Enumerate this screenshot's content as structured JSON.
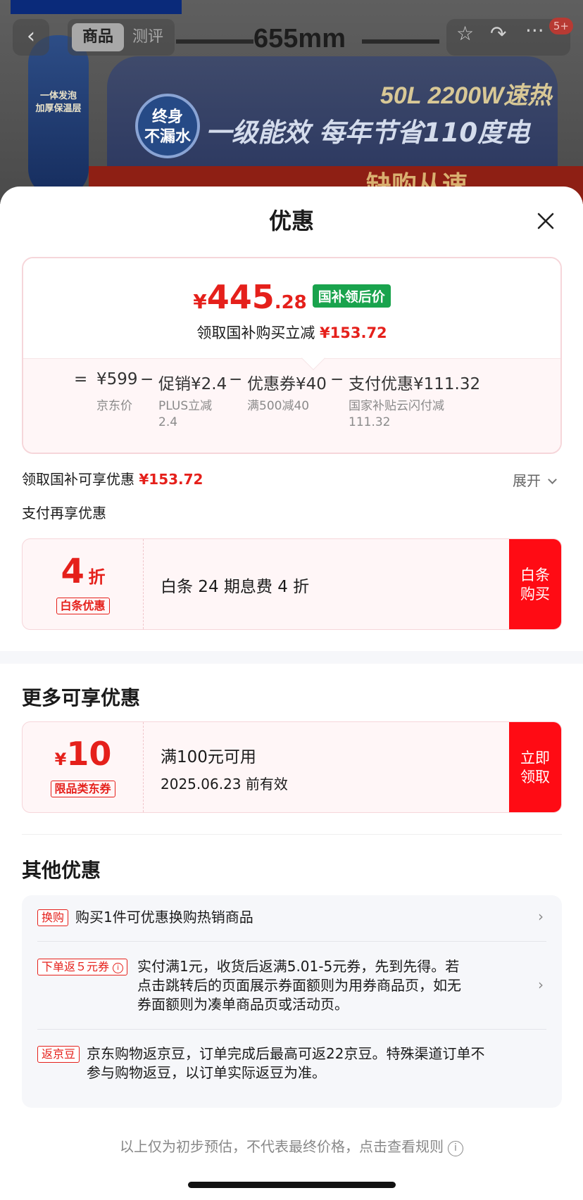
{
  "background": {
    "nav_back_label": "‹",
    "tabs": [
      "商品",
      "测评"
    ],
    "dimension_text": "655mm",
    "notification_badge": "5+",
    "pill_texts": [
      "一体发泡",
      "加厚保温层"
    ],
    "banner_capacity": "50L",
    "banner_power": "2200W速热",
    "banner_seal": [
      "终身",
      "不漏水"
    ],
    "banner_headline": "一级能效 每年节省110度电",
    "banner_red": "缺购从速"
  },
  "sheet": {
    "title": "优惠",
    "price": {
      "yen": "¥",
      "integer": "445",
      "decimal": ".28",
      "tag": "国补领后价",
      "sub_text": "领取国补购买立减",
      "sub_amount": "¥153.72"
    },
    "formula": {
      "eq": "=",
      "minus": "−",
      "jd_price": "¥599",
      "promo": "促销¥2.4",
      "coupon": "优惠券¥40",
      "payment": "支付优惠¥111.32",
      "jd_price_note": "京东价",
      "promo_note": [
        "PLUS立减",
        "2.4"
      ],
      "coupon_note": "满500减40",
      "payment_note": [
        "国家补贴云闪付减",
        "111.32"
      ]
    },
    "subsidy_label": "领取国补可享优惠",
    "subsidy_amount": "¥153.72",
    "expand_label": "展开",
    "pay_label": "支付再享优惠",
    "baitiao": {
      "value": "4",
      "unit": "折",
      "tag": "白条优惠",
      "text": "白条 24 期息费 4 折",
      "button": [
        "白条",
        "购买"
      ]
    },
    "more_title": "更多可享优惠",
    "coupon": {
      "yen": "¥",
      "value": "10",
      "tag": "限品类东券",
      "condition": "满100元可用",
      "expiry": "2025.06.23 前有效",
      "button": [
        "立即",
        "领取"
      ]
    },
    "other_title": "其他优惠",
    "other_items": [
      {
        "tag": "换购",
        "text": [
          "购买1件可优惠换购热销商品"
        ]
      },
      {
        "tag": "下单返５元券",
        "text": [
          "实付满1元，收货后返满5.01-5元券，先到先得。若",
          "点击跳转后的页面展示券面额则为用券商品页，如无",
          "券面额则为凑单商品页或活动页。"
        ]
      },
      {
        "tag": "返京豆",
        "text": [
          "京东购物返京豆，订单完成后最高可返22京豆。特殊渠道订单不",
          "参与购物返豆，以订单实际返豆为准。"
        ]
      }
    ],
    "footnote": "以上仅为初步预估，不代表最终价格，点击查看规则",
    "colors": {
      "accent_red": "#e5201b",
      "button_red": "#ff0b14",
      "tag_green": "#19a34d"
    }
  }
}
